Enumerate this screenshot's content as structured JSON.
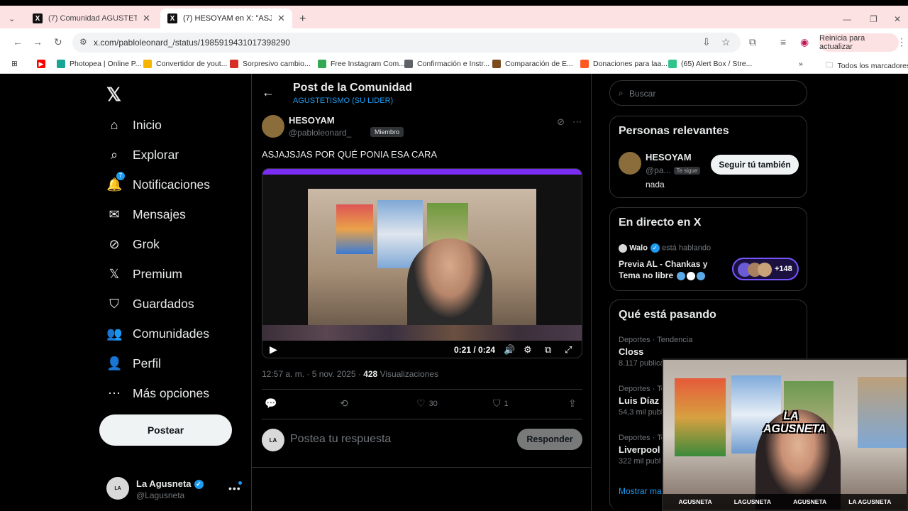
{
  "browser": {
    "tabs": [
      {
        "title": "(7) Comunidad AGUSTETISMO (SU",
        "active": false
      },
      {
        "title": "(7) HESOYAM en X: \"ASJAJSJAS",
        "active": true
      }
    ],
    "url": "x.com/pabloleonard_/status/1985919431017398290",
    "update_label": "Reinicia para actualizar",
    "bookmarks": [
      {
        "label": "Photopea | Online P...",
        "color": "#18a497"
      },
      {
        "label": "Convertidor de yout...",
        "color": "#f4b400"
      },
      {
        "label": "Sorpresivo cambio...",
        "color": "#d93025"
      },
      {
        "label": "Free Instagram Com...",
        "color": "#34a853"
      },
      {
        "label": "Confirmación e Instr...",
        "color": "#5f6368"
      },
      {
        "label": "Comparación de E...",
        "color": "#7b4a1e"
      },
      {
        "label": "Donaciones para laa...",
        "color": "#ff5722"
      },
      {
        "label": "(65) Alert Box / Stre...",
        "color": "#31c48d"
      }
    ],
    "all_bookmarks": "Todos los marcadores"
  },
  "nav": {
    "items": [
      {
        "label": "Inicio",
        "icon": "home-icon",
        "glyph": "⌂"
      },
      {
        "label": "Explorar",
        "icon": "search-icon",
        "glyph": "⌕"
      },
      {
        "label": "Notificaciones",
        "icon": "bell-icon",
        "glyph": "🔔"
      },
      {
        "label": "Mensajes",
        "icon": "mail-icon",
        "glyph": "✉"
      },
      {
        "label": "Grok",
        "icon": "grok-icon",
        "glyph": "⊘"
      },
      {
        "label": "Premium",
        "icon": "x-icon",
        "glyph": "𝕏"
      },
      {
        "label": "Guardados",
        "icon": "bookmark-icon",
        "glyph": "⛉"
      },
      {
        "label": "Comunidades",
        "icon": "people-icon",
        "glyph": "👥"
      },
      {
        "label": "Perfil",
        "icon": "person-icon",
        "glyph": "👤"
      },
      {
        "label": "Más opciones",
        "icon": "more-icon",
        "glyph": "⋯"
      }
    ],
    "notif_badge": "7",
    "post_button": "Postear",
    "me": {
      "name": "La Agusneta",
      "handle": "@Lagusneta"
    }
  },
  "main": {
    "header_title": "Post de la Comunidad",
    "header_sub": "AGUSTETISMO (SU LIDER)",
    "author_name": "HESOYAM",
    "author_handle": "@pabloleonard_",
    "member_badge": "Miembro",
    "text": "ASJAJSJAS POR QUÉ PONIA ESA CARA",
    "video_time": "0:21 / 0:24",
    "meta_time": "12:57 a. m. · 5 nov. 2025 · ",
    "views": "428",
    "views_label": " Visualizaciones",
    "likes": "30",
    "bookmarks": "1",
    "reply_placeholder": "Postea tu respuesta",
    "reply_button": "Responder"
  },
  "right": {
    "search_placeholder": "Buscar",
    "relevant_title": "Personas relevantes",
    "relevant_name": "HESOYAM",
    "relevant_handle": "@pa...",
    "follows_you": "Te sigue",
    "relevant_bio": "nada",
    "follow_button": "Seguir tú también",
    "live_title": "En directo en X",
    "live_host": "Walo",
    "live_status": "está hablando",
    "live_topic_1": "Previa AL - Chankas y",
    "live_topic_2": "Tema no libre",
    "live_count": "+148",
    "trends_title": "Qué está pasando",
    "trends": [
      {
        "category": "Deportes · Tendencia",
        "name": "Closs",
        "count": "8.117 publica"
      },
      {
        "category": "Deportes · Te",
        "name": "Luis Díaz",
        "count": "54,3 mil publ"
      },
      {
        "category": "Deportes · Te",
        "name": "Liverpool",
        "count": "322 mil publ"
      }
    ],
    "show_more": "Mostrar ma"
  },
  "overlay": {
    "logo_line1": "LA",
    "logo_line2": "AGUSNETA",
    "socials": [
      "AGUSNETA",
      "LAGUSNETA",
      "AGUSNETA",
      "LA AGUSNETA"
    ]
  }
}
